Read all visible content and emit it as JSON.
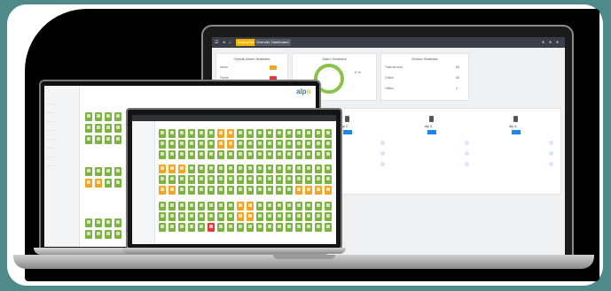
{
  "brand": {
    "logo_main": "alp",
    "logo_accent": "o"
  },
  "dashboard": {
    "topbar_buttons": [
      {
        "label": "Deployment",
        "color": "#f5b400"
      },
      {
        "label": "Overview",
        "color": "#555b63"
      },
      {
        "label": "Dashboard",
        "color": "#555b63"
      }
    ],
    "cards": [
      {
        "title": "Overall Alarm Statistics",
        "rows": [
          {
            "label": "Alarm",
            "color": "#f5a524"
          },
          {
            "label": "Flame",
            "color": "#e53935"
          },
          {
            "label": "Warning",
            "color": "#7cb342"
          }
        ]
      },
      {
        "title": "Alarm Statistics",
        "value": "0 %"
      },
      {
        "title": "Device Statistics",
        "rows": [
          {
            "label": "Total devices",
            "value": "68"
          },
          {
            "label": "Online",
            "value": "68"
          },
          {
            "label": "Offline",
            "value": "0"
          }
        ]
      }
    ],
    "devices": [
      {
        "name": "Alp 1"
      },
      {
        "name": "Alp 2"
      },
      {
        "name": "Alp 3"
      },
      {
        "name": "Alp 4"
      }
    ]
  },
  "colors": {
    "ok": "#7cb342",
    "warn": "#f5a524",
    "alarm": "#e53935",
    "accent": "#2d7ad6"
  }
}
